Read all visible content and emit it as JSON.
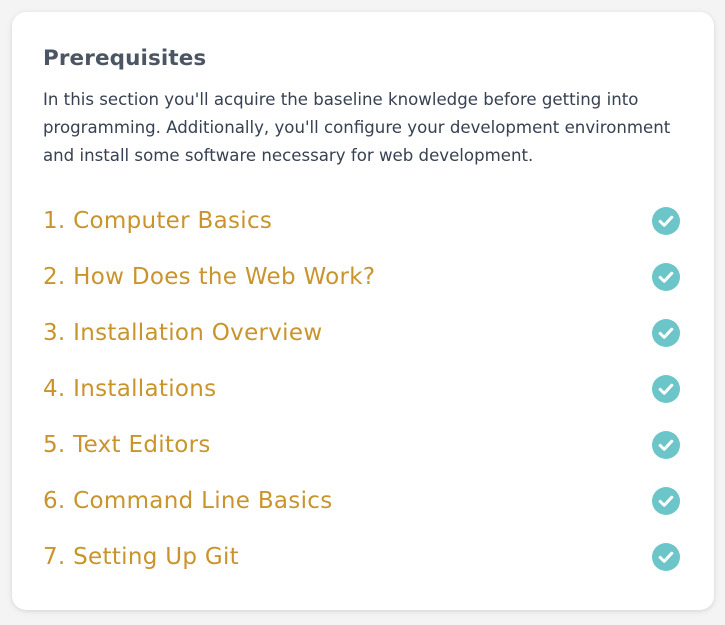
{
  "section": {
    "title": "Prerequisites",
    "description": "In this section you'll acquire the baseline knowledge before getting into programming. Additionally, you'll configure your development environment and install some software necessary for web development."
  },
  "lessons": [
    {
      "label": "1. Computer Basics",
      "status_icon": "check-circle-icon"
    },
    {
      "label": "2. How Does the Web Work?",
      "status_icon": "check-circle-icon"
    },
    {
      "label": "3. Installation Overview",
      "status_icon": "check-circle-icon"
    },
    {
      "label": "4. Installations",
      "status_icon": "check-circle-icon"
    },
    {
      "label": "5. Text Editors",
      "status_icon": "check-circle-icon"
    },
    {
      "label": "6. Command Line Basics",
      "status_icon": "check-circle-icon"
    },
    {
      "label": "7. Setting Up Git",
      "status_icon": "check-circle-icon"
    }
  ],
  "colors": {
    "link": "#c9942c",
    "check": "#6bc5c9",
    "title": "#4b5563",
    "text": "#374151"
  }
}
